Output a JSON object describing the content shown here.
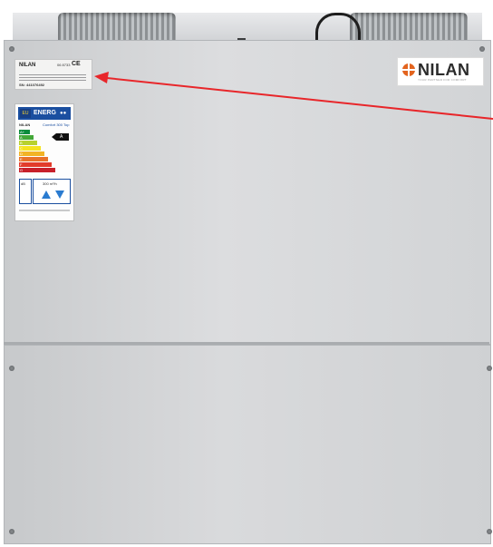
{
  "brand": {
    "logo_text": "NILAN",
    "tagline": "YOUR PARTNER FOR COMFORT"
  },
  "rating_plate": {
    "logo_text": "NILAN",
    "code": "06 8733",
    "ce_mark": "CE",
    "serial": "SN: 441076492"
  },
  "energy_label": {
    "header_eu": "EU",
    "header_text": "ENERG",
    "brand": "NILAN",
    "model": "Comfort 300 Top",
    "classes": [
      "A+",
      "A",
      "B",
      "C",
      "D",
      "E",
      "F",
      "G"
    ],
    "selected_class": "A",
    "sound_power": "dB",
    "airflow": "300 m³/h"
  },
  "colors": {
    "arrow": "#e8262a",
    "logo_accent": "#e3641e",
    "energy_blue": "#1b4fa0"
  }
}
